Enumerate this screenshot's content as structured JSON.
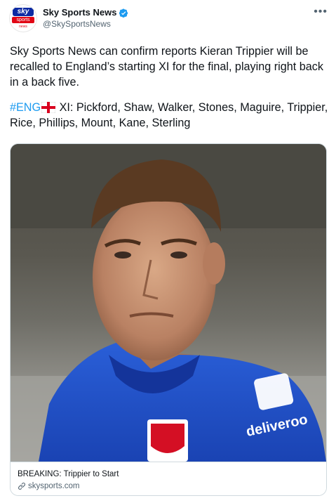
{
  "account": {
    "display_name": "Sky Sports News",
    "handle": "@SkySportsNews",
    "avatar_lines": [
      "sky",
      "sports",
      "news"
    ],
    "verified": true
  },
  "tweet": {
    "paragraph1": "Sky Sports News can confirm reports Kieran Trippier will be recalled to England’s starting XI for the final, playing right back in a back five.",
    "hashtag": "#ENG",
    "lineup_text": " XI: Pickford, Shaw, Walker, Stones, Maguire, Trippier, Rice, Phillips, Mount, Kane, Sterling"
  },
  "card": {
    "title": "BREAKING: Trippier to Start",
    "domain": "skysports.com",
    "shirt_text": "deliveroo"
  },
  "colors": {
    "hashtag": "#1d9bf0",
    "verified": "#1d9bf0",
    "shirt": "#1f4fc7",
    "sky_blue": "#0c2aa3",
    "sky_red": "#e10514"
  },
  "icons": {
    "more": "more-icon",
    "verified": "verified-badge-icon",
    "flag": "england-flag-icon",
    "link": "link-icon"
  }
}
